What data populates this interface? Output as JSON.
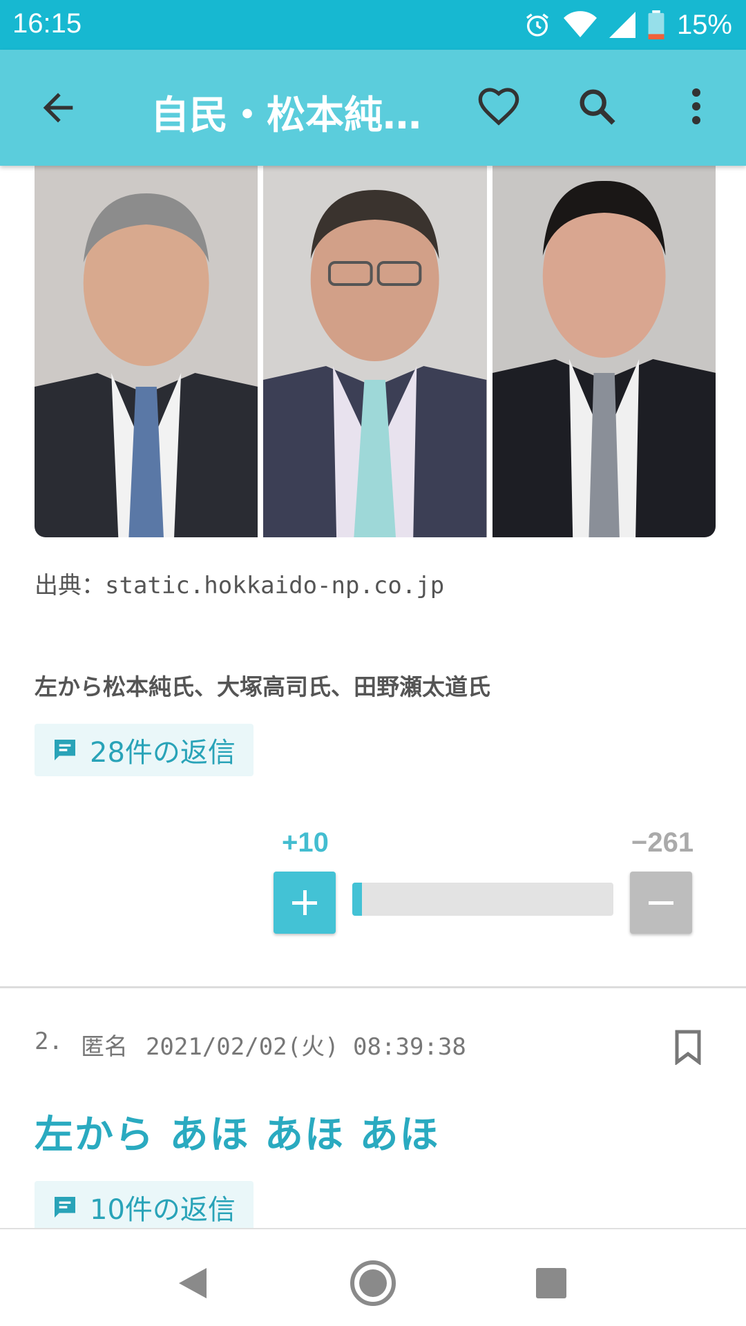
{
  "status_bar": {
    "time": "16:15",
    "battery_percent": "15%",
    "icons": [
      "alarm-icon",
      "wifi-icon",
      "signal-icon",
      "battery-icon"
    ]
  },
  "app_bar": {
    "title": "自民・松本純…",
    "icons": [
      "back-arrow-icon",
      "heart-icon",
      "search-icon",
      "more-vert-icon"
    ]
  },
  "post": {
    "source": "出典：static.hokkaido-np.co.jp",
    "caption": "左から松本純氏、大塚高司氏、田野瀬太道氏",
    "replies_label": "28件の返信",
    "vote": {
      "plus": "+10",
      "minus": "−261",
      "plus_ratio": 0.037
    }
  },
  "comment": {
    "number": "2.",
    "author": "匿名",
    "datetime": "2021/02/02(火) 08:39:38",
    "body": "左から あほ あほ あほ",
    "replies_label": "10件の返信"
  },
  "colors": {
    "status_bar": "#17b8d1",
    "app_bar": "#5bcddc",
    "accent": "#2aaac0",
    "vote_plus": "#43c2d5",
    "vote_minus": "#bdbdbd"
  },
  "nav_bar": {
    "icons": [
      "nav-back-icon",
      "nav-home-icon",
      "nav-recent-icon"
    ]
  }
}
